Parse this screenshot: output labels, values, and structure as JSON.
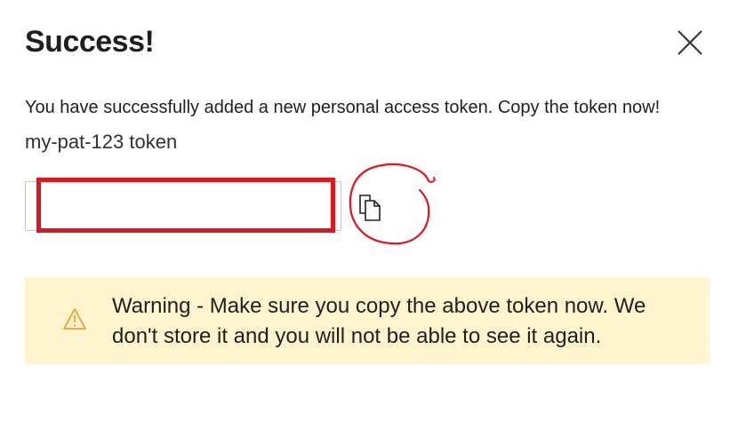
{
  "dialog": {
    "title": "Success!",
    "close_icon": "close-icon",
    "message": "You have successfully added a new personal access token. Copy the token now!",
    "token_name": "my-pat-123 token",
    "token_field": {
      "value": "",
      "placeholder": ""
    },
    "copy_icon": "copy-icon",
    "warning": {
      "icon": "warning-icon",
      "text": "Warning - Make sure you copy the above token now. We don't store it and you will not be able to see it again."
    }
  },
  "colors": {
    "annotation_red": "#e3141a",
    "warning_background": "#fff4ce",
    "warning_icon": "#f0a02c",
    "text": "#201f1e"
  }
}
